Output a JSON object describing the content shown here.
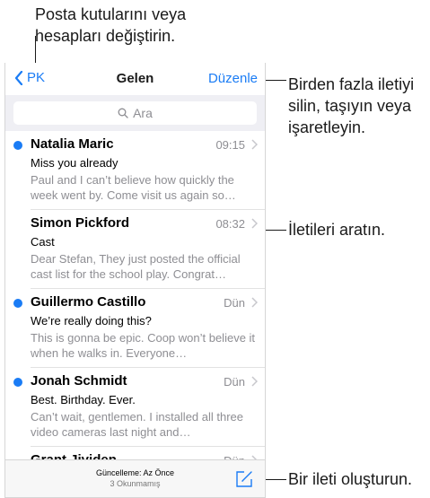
{
  "callouts": {
    "top": "Posta kutularını veya hesapları değiştirin.",
    "right_top": "Birden fazla iletiyi silin, taşıyın veya işaretleyin.",
    "right_middle": "İletileri aratın.",
    "right_bottom": "Bir ileti oluşturun."
  },
  "nav": {
    "back_label": "PK",
    "title": "Gelen",
    "edit_label": "Düzenle"
  },
  "search": {
    "placeholder": "Ara"
  },
  "messages": [
    {
      "sender": "Natalia Maric",
      "time": "09:15",
      "subject": "Miss you already",
      "preview": "Paul and I can’t believe how quickly the week went by. Come visit us again so…",
      "unread": true
    },
    {
      "sender": "Simon Pickford",
      "time": "08:32",
      "subject": "Cast",
      "preview": "Dear Stefan, They just posted the official cast list for the school play. Congrat…",
      "unread": false
    },
    {
      "sender": "Guillermo Castillo",
      "time": "Dün",
      "subject": "We’re really doing this?",
      "preview": "This is gonna be epic. Coop won’t believe it when he walks in. Everyone…",
      "unread": true
    },
    {
      "sender": "Jonah Schmidt",
      "time": "Dün",
      "subject": "Best. Birthday. Ever.",
      "preview": "Can’t wait, gentlemen. I installed all three video cameras last night and…",
      "unread": true
    },
    {
      "sender": "Grant Jividen",
      "time": "Dün",
      "subject": "",
      "preview": "",
      "unread": false
    }
  ],
  "toolbar": {
    "updated": "Güncelleme: Az Önce",
    "unread_count": "3 Okunmamış"
  },
  "colors": {
    "accent": "#1a7cf5",
    "secondary_text": "#8e8e93"
  }
}
